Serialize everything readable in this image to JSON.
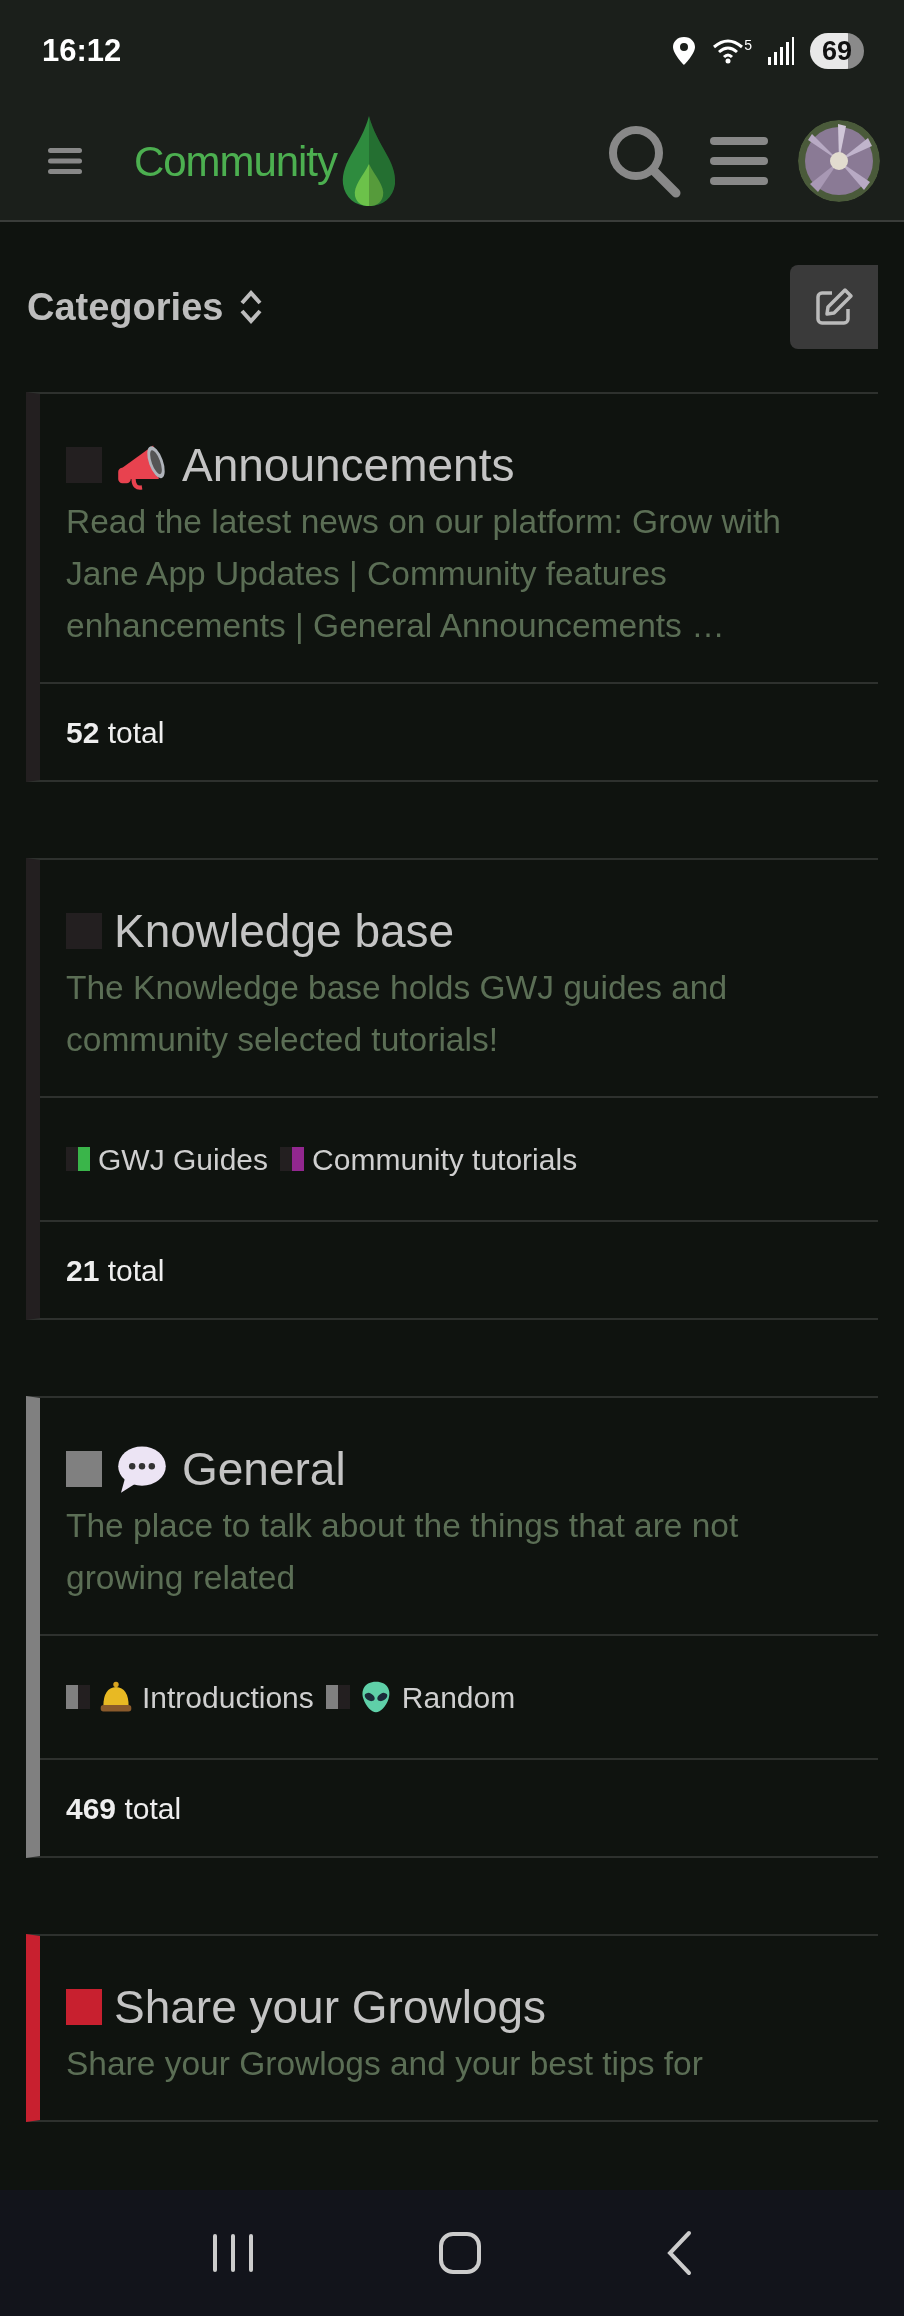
{
  "status_bar": {
    "time": "16:12",
    "wifi_label": "5",
    "battery": "69"
  },
  "header": {
    "logo_text": "Community"
  },
  "page": {
    "title": "Categories"
  },
  "categories": [
    {
      "name": "Announcements",
      "color": "#231f20",
      "description": "Read the latest news on our platform: Grow with Jane App Updates | Community features enhancements | General Announcements …",
      "total": "**52** total"
    },
    {
      "name": "Knowledge base",
      "color": "#231f20",
      "description": "The Knowledge base holds GWJ guides and community selected tutorials!",
      "subcategories": [
        {
          "name": "GWJ Guides",
          "color": "#3ab54a"
        },
        {
          "name": "Community tutorials",
          "color": "#92278f"
        }
      ],
      "total": "**21** total"
    },
    {
      "name": "General",
      "color": "#808080",
      "description": "The place to talk about the things that are not growing related",
      "subcategories": [
        {
          "name": "Introductions",
          "color": "#231f20"
        },
        {
          "name": "Random",
          "color": "#231f20"
        }
      ],
      "total": "**469** total"
    },
    {
      "name": "Share your Growlogs",
      "color": "#c8202f",
      "description": "Share your Growlogs and your best tips for"
    }
  ]
}
